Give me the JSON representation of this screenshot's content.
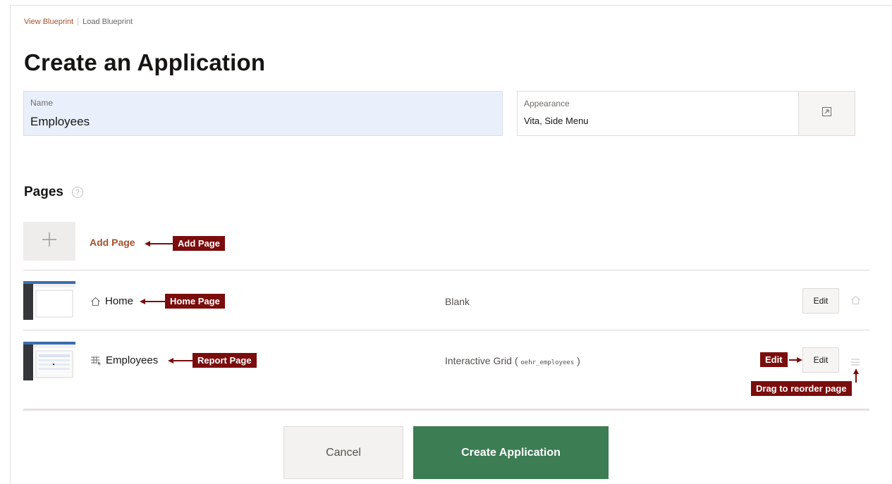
{
  "header": {
    "view_blueprint": "View Blueprint",
    "load_blueprint": "Load Blueprint",
    "title": "Create an Application"
  },
  "form": {
    "name_label": "Name",
    "name_value": "Employees",
    "appearance_label": "Appearance",
    "appearance_value": "Vita, Side Menu"
  },
  "pages_section": {
    "heading": "Pages",
    "help_glyph": "?",
    "add_page_label": "Add Page",
    "rows": [
      {
        "name": "Home",
        "type": "Blank",
        "edit_label": "Edit",
        "icon": "home-icon"
      },
      {
        "name": "Employees",
        "type_prefix": "Interactive Grid ( ",
        "type_table": "oehr_employees",
        "type_suffix": " )",
        "edit_label": "Edit",
        "icon": "grid-icon"
      }
    ]
  },
  "annotations": {
    "add_page": "Add Page",
    "home_page": "Home Page",
    "report_page": "Report Page",
    "edit": "Edit",
    "drag": "Drag to reorder page"
  },
  "footer": {
    "cancel_label": "Cancel",
    "create_label": "Create Application"
  },
  "colors": {
    "link": "#a5512d",
    "create_button": "#3c7d53",
    "annotation": "#7b0d0d",
    "name_field_bg": "#e9f0fb"
  }
}
